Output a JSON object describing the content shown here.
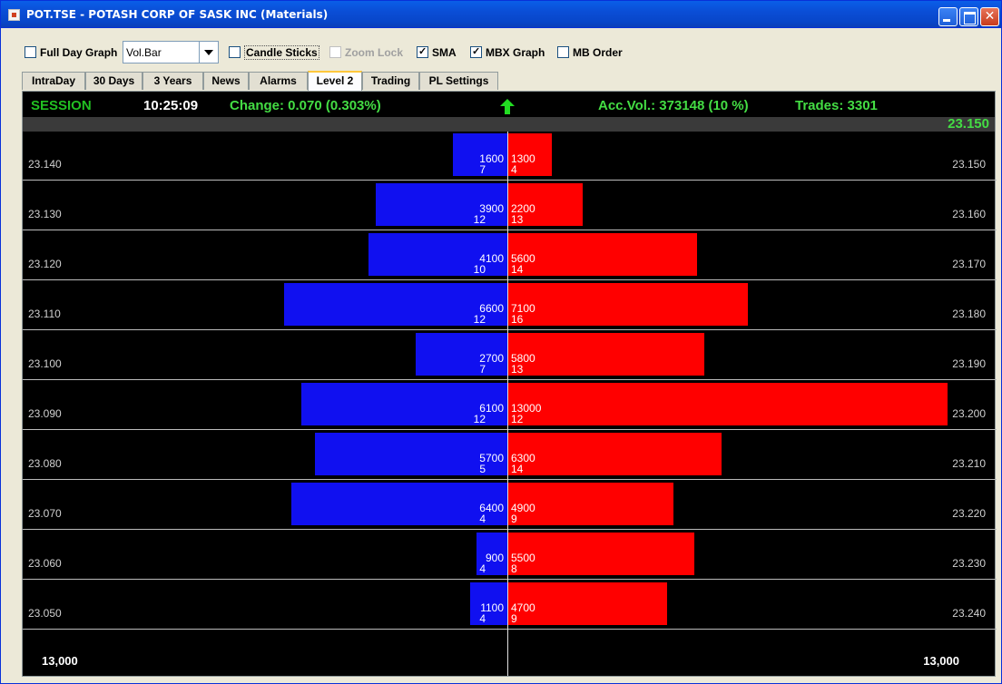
{
  "window": {
    "title": "POT.TSE - POTASH CORP OF SASK INC (Materials)",
    "controls": [
      "minimize-icon",
      "maximize-icon",
      "close-icon"
    ]
  },
  "toolbar": {
    "full_day_graph": {
      "label": "Full Day Graph",
      "checked": false
    },
    "chart_style": {
      "value": "Vol.Bar"
    },
    "candle_sticks": {
      "label": "Candle Sticks",
      "checked": false
    },
    "zoom_lock": {
      "label": "Zoom Lock",
      "checked": false,
      "enabled": false
    },
    "sma": {
      "label": "SMA",
      "checked": true
    },
    "mbx_graph": {
      "label": "MBX Graph",
      "checked": true
    },
    "mb_order": {
      "label": "MB Order",
      "checked": false
    }
  },
  "tabs": [
    {
      "label": "IntraDay"
    },
    {
      "label": "30 Days"
    },
    {
      "label": "3 Years"
    },
    {
      "label": "News"
    },
    {
      "label": "Alarms"
    },
    {
      "label": "Level 2",
      "active": true
    },
    {
      "label": "Trading"
    },
    {
      "label": "PL Settings"
    }
  ],
  "header": {
    "session": "SESSION",
    "time": "10:25:09",
    "change": "Change: 0.070 (0.303%)",
    "direction": "up-arrow-icon",
    "acc_vol": "Acc.Vol.: 373148 (10 %)",
    "trades": "Trades: 3301",
    "last_price": "23.150"
  },
  "colors": {
    "bid": "#1010f0",
    "ask": "#ff0000",
    "positive": "#44dd44",
    "background": "#000000"
  },
  "scale": {
    "left": "13,000",
    "right": "13,000",
    "max_volume": 13000
  },
  "book": [
    {
      "bid_price": "23.140",
      "bid_size": "1600",
      "bid_orders": "7",
      "ask_size": "1300",
      "ask_orders": "4",
      "ask_price": "23.150",
      "bid_vol": 1600,
      "ask_vol": 1300
    },
    {
      "bid_price": "23.130",
      "bid_size": "3900",
      "bid_orders": "12",
      "ask_size": "2200",
      "ask_orders": "13",
      "ask_price": "23.160",
      "bid_vol": 3900,
      "ask_vol": 2200
    },
    {
      "bid_price": "23.120",
      "bid_size": "4100",
      "bid_orders": "10",
      "ask_size": "5600",
      "ask_orders": "14",
      "ask_price": "23.170",
      "bid_vol": 4100,
      "ask_vol": 5600
    },
    {
      "bid_price": "23.110",
      "bid_size": "6600",
      "bid_orders": "12",
      "ask_size": "7100",
      "ask_orders": "16",
      "ask_price": "23.180",
      "bid_vol": 6600,
      "ask_vol": 7100
    },
    {
      "bid_price": "23.100",
      "bid_size": "2700",
      "bid_orders": "7",
      "ask_size": "5800",
      "ask_orders": "13",
      "ask_price": "23.190",
      "bid_vol": 2700,
      "ask_vol": 5800
    },
    {
      "bid_price": "23.090",
      "bid_size": "6100",
      "bid_orders": "12",
      "ask_size": "13000",
      "ask_orders": "12",
      "ask_price": "23.200",
      "bid_vol": 6100,
      "ask_vol": 13000
    },
    {
      "bid_price": "23.080",
      "bid_size": "5700",
      "bid_orders": "5",
      "ask_size": "6300",
      "ask_orders": "14",
      "ask_price": "23.210",
      "bid_vol": 5700,
      "ask_vol": 6300
    },
    {
      "bid_price": "23.070",
      "bid_size": "6400",
      "bid_orders": "4",
      "ask_size": "4900",
      "ask_orders": "9",
      "ask_price": "23.220",
      "bid_vol": 6400,
      "ask_vol": 4900
    },
    {
      "bid_price": "23.060",
      "bid_size": "900",
      "bid_orders": "4",
      "ask_size": "5500",
      "ask_orders": "8",
      "ask_price": "23.230",
      "bid_vol": 900,
      "ask_vol": 5500
    },
    {
      "bid_price": "23.050",
      "bid_size": "1100",
      "bid_orders": "4",
      "ask_size": "4700",
      "ask_orders": "9",
      "ask_price": "23.240",
      "bid_vol": 1100,
      "ask_vol": 4700
    }
  ]
}
